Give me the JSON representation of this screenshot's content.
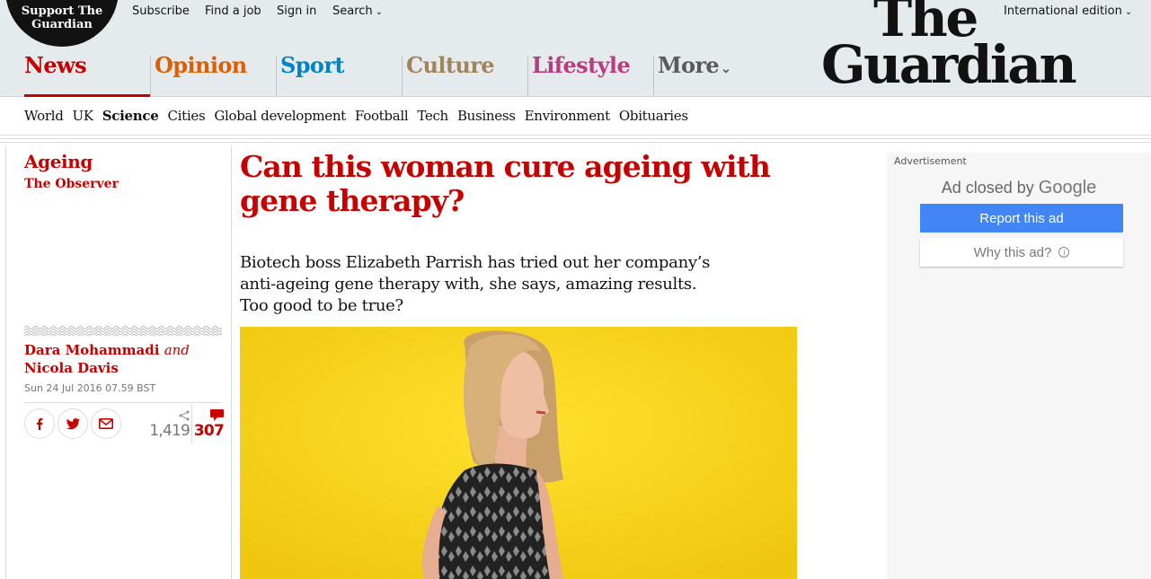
{
  "header": {
    "support": "Support The Guardian",
    "utility": {
      "subscribe": "Subscribe",
      "find_job": "Find a job",
      "sign_in": "Sign in",
      "search": "Search",
      "edition": "International edition"
    },
    "logo_line1": "The",
    "logo_line2": "Guardian",
    "pillars": [
      {
        "label": "News",
        "color": "#c70000"
      },
      {
        "label": "Opinion",
        "color": "#e05e00"
      },
      {
        "label": "Sport",
        "color": "#0084c6"
      },
      {
        "label": "Culture",
        "color": "#a1845c"
      },
      {
        "label": "Lifestyle",
        "color": "#bb3b80"
      },
      {
        "label": "More",
        "color": "#5a5a5a"
      }
    ]
  },
  "subnav": [
    "World",
    "UK",
    "Science",
    "Cities",
    "Global development",
    "Football",
    "Tech",
    "Business",
    "Environment",
    "Obituaries"
  ],
  "article": {
    "section": "Ageing",
    "series": "The Observer",
    "author1": "Dara Mohammadi",
    "and": "and",
    "author2": "Nicola Davis",
    "date": "Sun 24 Jul 2016 07.59 BST",
    "share_count": "1,419",
    "comment_count": "307",
    "headline": "Can this woman cure ageing with gene therapy?",
    "standfirst": "Biotech boss Elizabeth Parrish has tried out her company’s anti-ageing gene therapy with, she says, amazing results. Too good to be true?"
  },
  "ad": {
    "label": "Advertisement",
    "closed_prefix": "Ad closed by",
    "closed_brand": "Google",
    "report": "Report this ad",
    "why": "Why this ad?"
  },
  "icons": [
    "facebook-icon",
    "twitter-icon",
    "email-icon",
    "share-icon",
    "comment-icon",
    "chevron-down-icon",
    "info-icon"
  ]
}
